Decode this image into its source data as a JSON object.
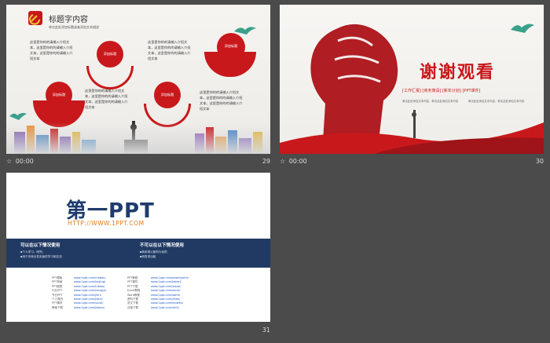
{
  "slides": [
    {
      "number": "29",
      "timing": "00:00",
      "title": "标题字内容",
      "subtitle": "单击此处添加标题或者添加文本描述",
      "labels": [
        "添加标题",
        "添加标题",
        "添加标题",
        "添加标题"
      ],
      "paragraph": "这里是你的的请输入介绍文本，这里是你的的请输入介绍文本，这里是你的的请输入介绍文本"
    },
    {
      "number": "30",
      "timing": "00:00",
      "heading": "谢谢观看",
      "tags": "[工作汇报] [商务简请] [新年计划] [PPT课件]",
      "caption": "单击此处添加文本内容，单击此处添加文本内容"
    },
    {
      "number": "31",
      "timing": "00:00",
      "logo": "第一PPT",
      "url": "HTTP://WWW.1PPT.COM",
      "can_use_title": "可以在以下情况使用",
      "can_use_text": [
        "▪个人学习、研究；",
        "▪用于非商业性用途的学习和交流"
      ],
      "cannot_use_title": "不可以在以下情况使用",
      "cannot_use_text": [
        "▪商用或以营利为目的",
        "▪转售或出租"
      ],
      "link_labels_left": [
        "PPT模板",
        "PPT背景",
        "PPT图表",
        "行业PPT",
        "节日PPT",
        "个人简历",
        "PPT素材",
        "教案下载"
      ],
      "links_left": [
        "www.1ppt.com/moban/",
        "www.1ppt.com/beijing/",
        "www.1ppt.com/tubiao/",
        "www.1ppt.com/hangye/",
        "www.1ppt.com/jieri/",
        "www.1ppt.com/jianli/",
        "www.1ppt.com/sucai/",
        "www.1ppt.com/jiaoan/"
      ],
      "link_labels_right": [
        "PPT教程",
        "PPT课件",
        "PPT下载",
        "Excel教程",
        "Word教程",
        "资料下载",
        "范文下载",
        "试卷下载"
      ],
      "links_right": [
        "www.1ppt.com/powerpoint/",
        "www.1ppt.com/kejian/",
        "www.1ppt.com/xiazai/",
        "www.1ppt.com/excel/",
        "www.1ppt.com/word/",
        "www.1ppt.com/ziliao/",
        "www.1ppt.com/fanwen/",
        "www.1ppt.com/shiti/"
      ]
    }
  ],
  "colors": {
    "party_red": "#c9181b",
    "navy": "#213a63",
    "orange": "#e07a1a",
    "gold": "#f0c23a",
    "link": "#1a55c8"
  }
}
